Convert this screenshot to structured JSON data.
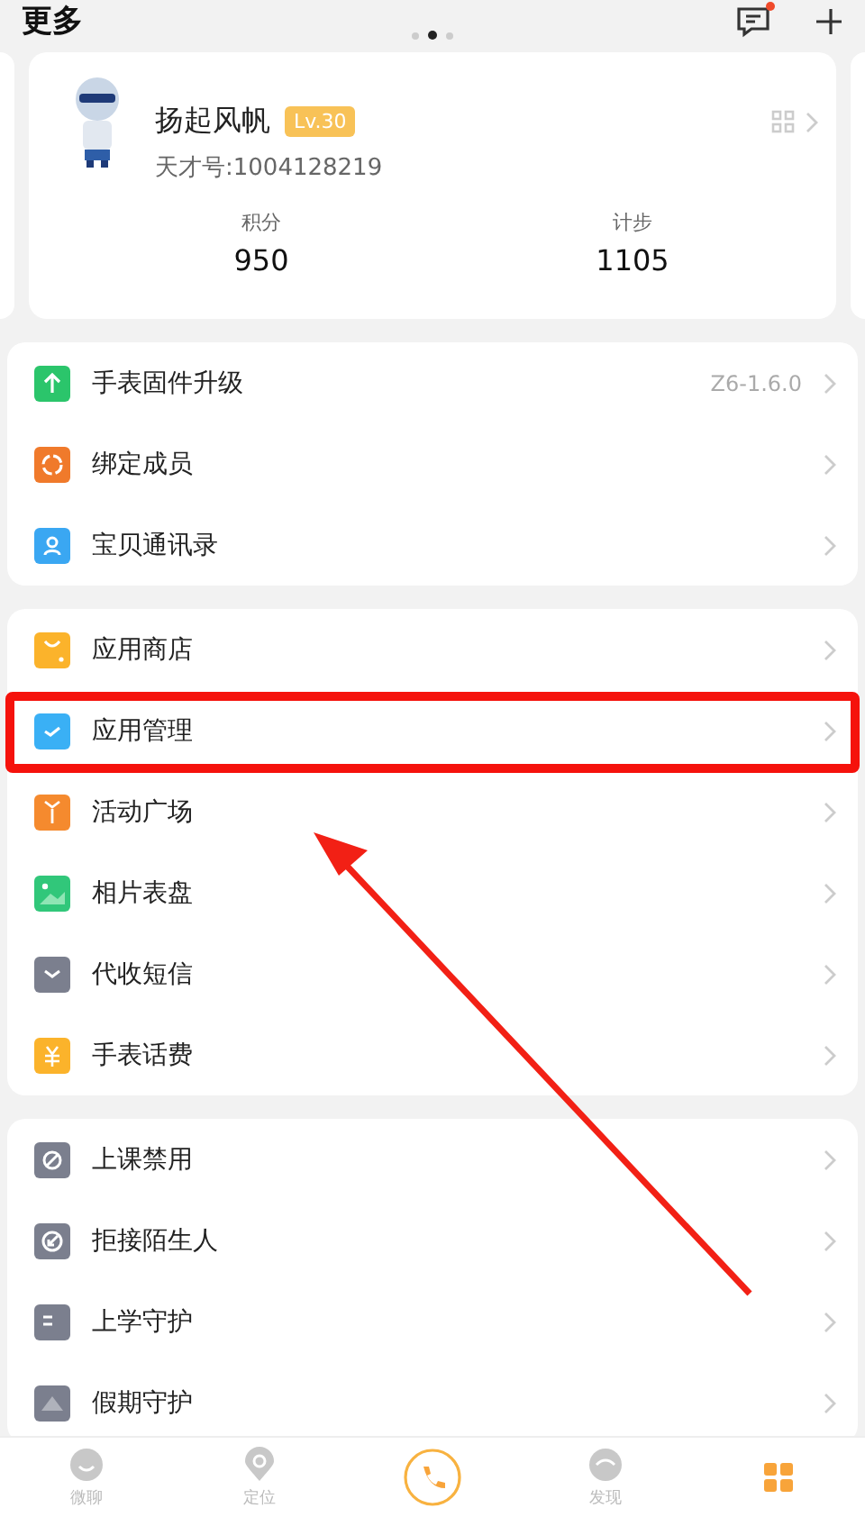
{
  "header": {
    "title": "更多",
    "pager": [
      {
        "selected": false
      },
      {
        "selected": true
      },
      {
        "selected": false
      }
    ],
    "message_badge": true
  },
  "profile": {
    "name": "扬起风帆",
    "level": "Lv.30",
    "id_text": "天才号:1004128219",
    "stats": [
      {
        "label": "积分",
        "value": "950"
      },
      {
        "label": "计步",
        "value": "1105"
      }
    ]
  },
  "groups": [
    {
      "items": [
        {
          "label": "手表固件升级",
          "value": "Z6-1.6.0",
          "kind": "upgrade",
          "highlighted": false
        },
        {
          "label": "绑定成员",
          "kind": "members",
          "highlighted": false
        },
        {
          "label": "宝贝通讯录",
          "kind": "contacts",
          "highlighted": false
        }
      ]
    },
    {
      "items": [
        {
          "label": "应用商店",
          "kind": "store",
          "highlighted": false
        },
        {
          "label": "应用管理",
          "kind": "apps",
          "highlighted": true
        },
        {
          "label": "活动广场",
          "kind": "gift",
          "highlighted": false
        },
        {
          "label": "相片表盘",
          "kind": "photo",
          "highlighted": false
        },
        {
          "label": "代收短信",
          "kind": "sms",
          "highlighted": false
        },
        {
          "label": "手表话费",
          "kind": "fee",
          "highlighted": false
        }
      ]
    },
    {
      "items": [
        {
          "label": "上课禁用",
          "kind": "forbid",
          "highlighted": false
        },
        {
          "label": "拒接陌生人",
          "kind": "reject",
          "highlighted": false
        },
        {
          "label": "上学守护",
          "kind": "school",
          "highlighted": false
        },
        {
          "label": "假期守护",
          "kind": "holiday",
          "highlighted": false
        }
      ]
    }
  ],
  "tabbar": [
    {
      "label": "微聊",
      "kind": "chat",
      "selected": false
    },
    {
      "label": "定位",
      "kind": "locate",
      "selected": false
    },
    {
      "kind": "call",
      "selected": false
    },
    {
      "label": "发现",
      "kind": "discover",
      "selected": false
    },
    {
      "kind": "more",
      "selected": true
    }
  ],
  "annotation": {
    "arrow": true
  }
}
